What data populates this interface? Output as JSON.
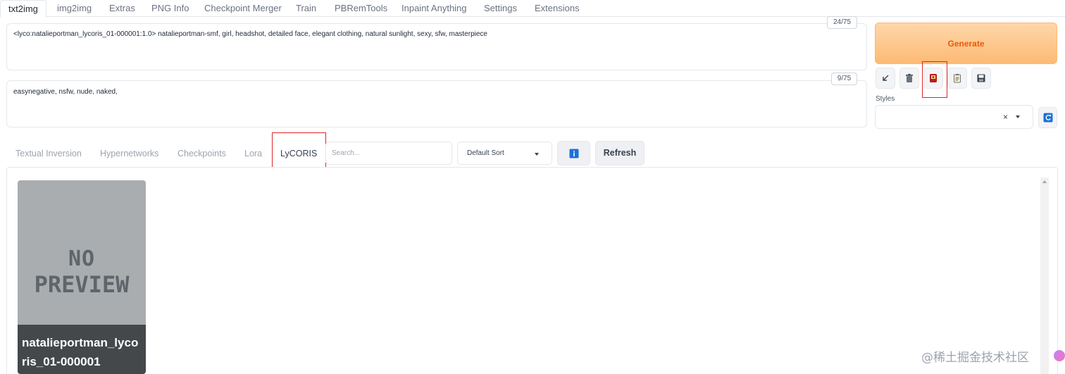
{
  "top_tabs": [
    "txt2img",
    "img2img",
    "Extras",
    "PNG Info",
    "Checkpoint Merger",
    "Train",
    "PBRemTools",
    "Inpaint Anything",
    "Settings",
    "Extensions"
  ],
  "prompt": {
    "text": "<lyco:natalieportman_lycoris_01-000001:1.0> natalieportman-smf, girl, headshot, detailed face, elegant clothing, natural sunlight, sexy, sfw, masterpiece",
    "token_count": "24/75"
  },
  "negative_prompt": {
    "text": "easynegative, nsfw, nude, naked,",
    "token_count": "9/75"
  },
  "generate_label": "Generate",
  "styles": {
    "label": "Styles",
    "clear": "×"
  },
  "network_tabs": [
    "Textual Inversion",
    "Hypernetworks",
    "Checkpoints",
    "Lora",
    "LyCORIS"
  ],
  "active_network_tab": "LyCORIS",
  "search": {
    "placeholder": "Search...",
    "value": ""
  },
  "sort": {
    "selected": "Default Sort"
  },
  "refresh_label": "Refresh",
  "cards": [
    {
      "name": "natalieportman_lycoris_01-000001",
      "preview_line1": "NO",
      "preview_line2": "PREVIEW"
    }
  ],
  "watermark": "@稀土掘金技术社区",
  "colors": {
    "generate_bg": "#fdba74",
    "generate_text": "#ea580c",
    "highlight_box": "#dc2626"
  }
}
